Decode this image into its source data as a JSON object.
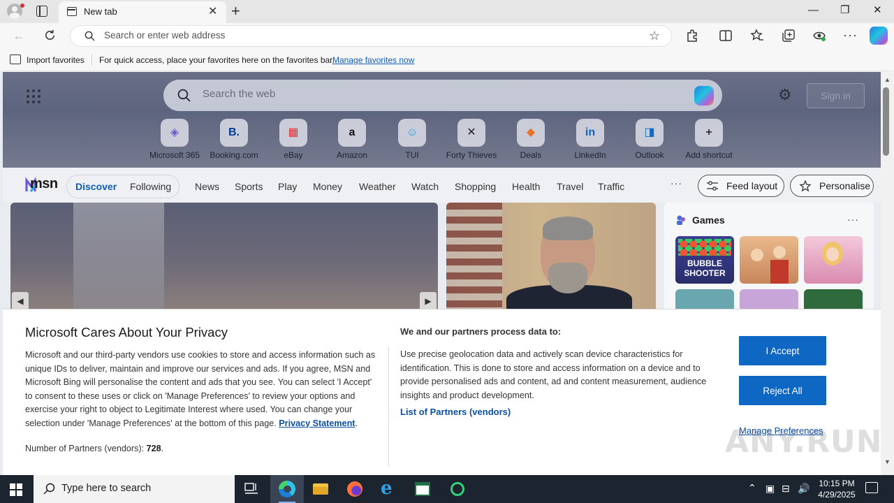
{
  "browser": {
    "tab_title": "New tab",
    "tab_close": "✕",
    "new_tab": "+",
    "window_minimize": "—",
    "window_restore": "❐",
    "window_close": "✕",
    "address_placeholder": "Search or enter web address",
    "favorites_bar": {
      "import_label": "Import favorites",
      "message": "For quick access, place your favorites here on the favorites bar.",
      "manage_link": "Manage favorites now"
    }
  },
  "newtab": {
    "search_placeholder": "Search the web",
    "sign_in": "Sign in",
    "shortcuts": [
      {
        "label": "Microsoft 365",
        "icon": "microsoft-365-icon",
        "color": "#6a5acd"
      },
      {
        "label": "Booking.com",
        "icon": "booking-icon",
        "color": "#003b95"
      },
      {
        "label": "eBay",
        "icon": "ebay-icon",
        "color": "#e53238"
      },
      {
        "label": "Amazon",
        "icon": "amazon-icon",
        "color": "#111111"
      },
      {
        "label": "TUI",
        "icon": "tui-icon",
        "color": "#1aa3e8"
      },
      {
        "label": "Forty Thieves",
        "icon": "forty-thieves-icon",
        "color": "#222222"
      },
      {
        "label": "Deals",
        "icon": "deals-icon",
        "color": "#e8732a"
      },
      {
        "label": "LinkedIn",
        "icon": "linkedin-icon",
        "color": "#0a66c2"
      },
      {
        "label": "Outlook",
        "icon": "outlook-icon",
        "color": "#0f6cbd"
      },
      {
        "label": "Add shortcut",
        "icon": "plus-icon",
        "color": "#333333"
      }
    ],
    "msn": {
      "logo": "msn",
      "discover": "Discover",
      "following": "Following",
      "nav": [
        "News",
        "Sports",
        "Play",
        "Money",
        "Weather",
        "Watch",
        "Shopping",
        "Health",
        "Travel",
        "Traffic"
      ],
      "more": "···",
      "feed_layout": "Feed layout",
      "personalise": "Personalise"
    },
    "games": {
      "title": "Games",
      "more": "···",
      "first_tile_text": "BUBBLE SHOOTER"
    }
  },
  "consent": {
    "title": "Microsoft Cares About Your Privacy",
    "body": "Microsoft and our third-party vendors use cookies to store and access information such as unique IDs to deliver, maintain and improve our services and ads. If you agree, MSN and Microsoft Bing will personalise the content and ads that you see. You can select 'I Accept' to consent to these uses or click on 'Manage Preferences' to review your options and exercise your right to object to Legitimate Interest where used.  You can change your selection under 'Manage Preferences' at the bottom of this page.",
    "privacy_link": "Privacy Statement",
    "partners_label": "Number of Partners (vendors):",
    "partners_count": "728",
    "process_heading": "We and our partners process data to:",
    "process_text": "Use precise geolocation data and actively scan device characteristics for identification. This is done to store and access information on a device and to provide personalised ads and content, ad and content measurement, audience insights and product development.",
    "list_partners": "List of Partners (vendors)",
    "accept": "I Accept",
    "reject": "Reject All",
    "manage": "Manage Preferences",
    "watermark": "ANY.RUN"
  },
  "taskbar": {
    "search_placeholder": "Type here to search",
    "time": "10:15 PM",
    "date": "4/29/2025",
    "apps": [
      "task-view-icon",
      "edge-icon",
      "file-explorer-icon",
      "firefox-icon",
      "internet-explorer-icon",
      "excel-icon",
      "bing-search-icon"
    ]
  }
}
